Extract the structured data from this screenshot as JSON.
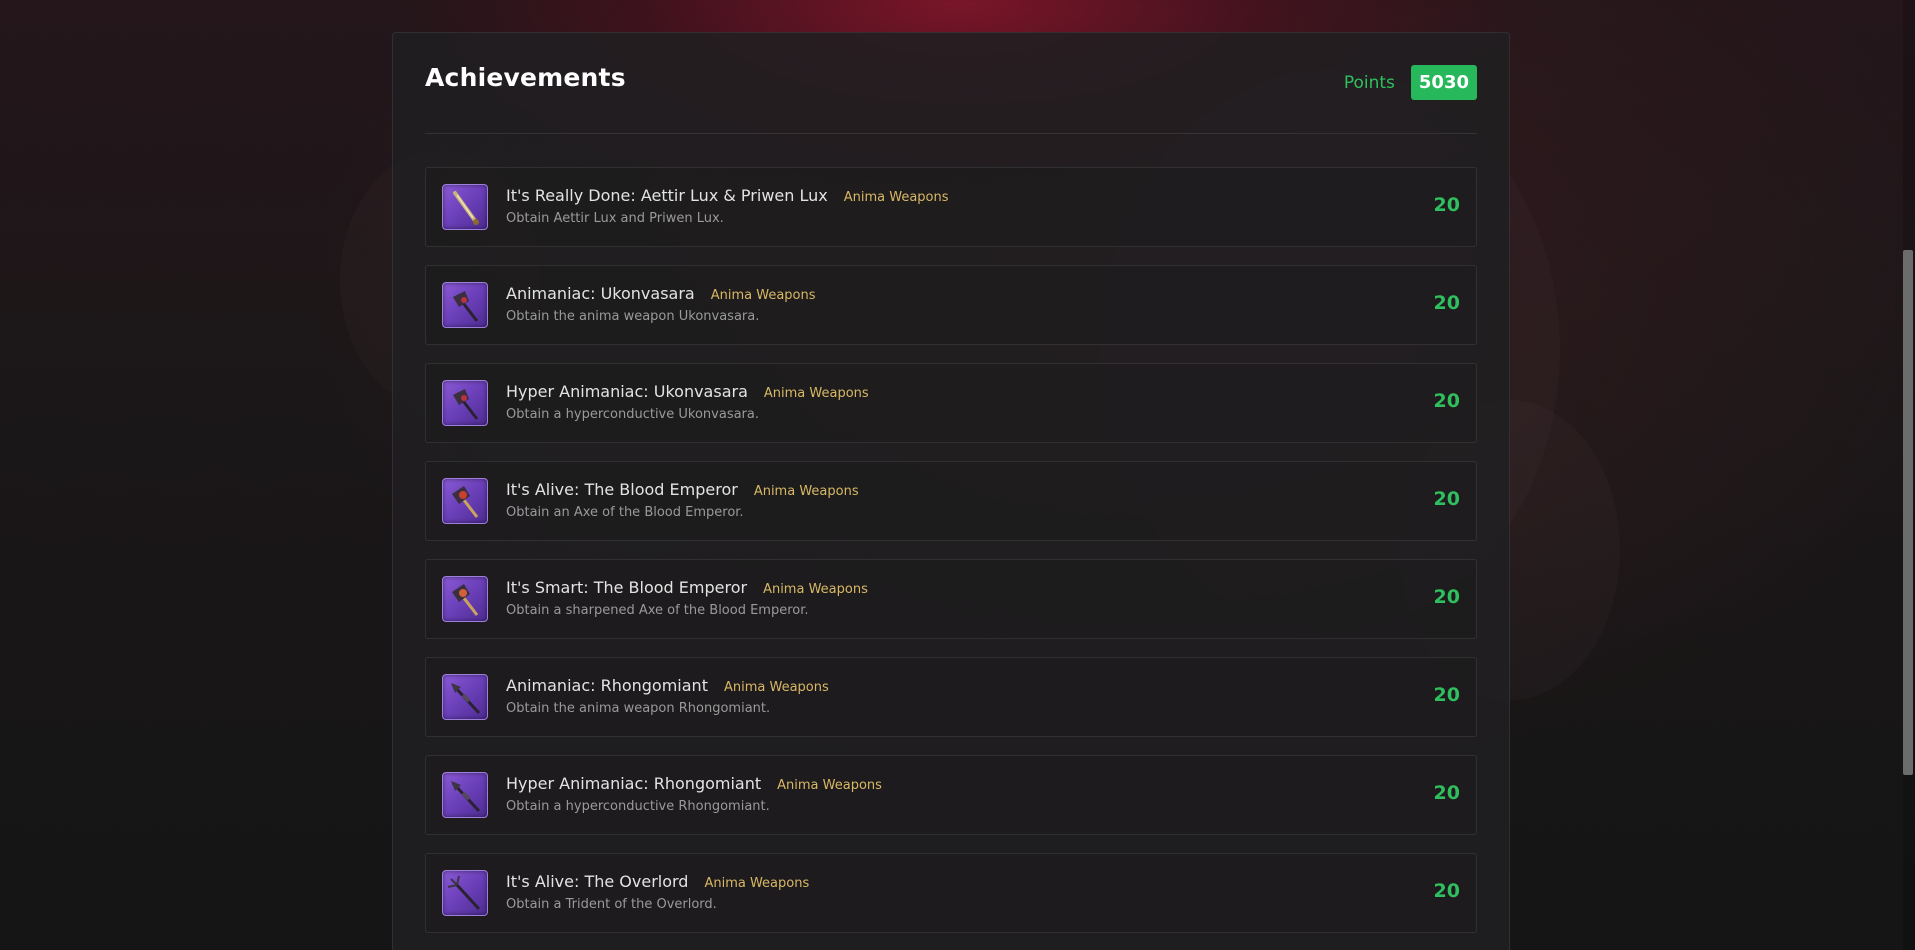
{
  "page": {
    "title": "Achievements",
    "points_label": "Points",
    "points_value": "5030"
  },
  "colors": {
    "accent_green": "#26b85a",
    "category_gold": "#d8b865",
    "icon_purple": "#6a3fb8"
  },
  "achievements": [
    {
      "title": "It's Really Done: Aettir Lux & Priwen Lux",
      "category": "Anima Weapons",
      "description": "Obtain Aettir Lux and Priwen Lux.",
      "points": "20",
      "icon": "sword-icon"
    },
    {
      "title": "Animaniac: Ukonvasara",
      "category": "Anima Weapons",
      "description": "Obtain the anima weapon Ukonvasara.",
      "points": "20",
      "icon": "axe-icon"
    },
    {
      "title": "Hyper Animaniac: Ukonvasara",
      "category": "Anima Weapons",
      "description": "Obtain a hyperconductive Ukonvasara.",
      "points": "20",
      "icon": "axe-icon"
    },
    {
      "title": "It's Alive: The Blood Emperor",
      "category": "Anima Weapons",
      "description": "Obtain an Axe of the Blood Emperor.",
      "points": "20",
      "icon": "axe-icon"
    },
    {
      "title": "It's Smart: The Blood Emperor",
      "category": "Anima Weapons",
      "description": "Obtain a sharpened Axe of the Blood Emperor.",
      "points": "20",
      "icon": "axe-icon"
    },
    {
      "title": "Animaniac: Rhongomiant",
      "category": "Anima Weapons",
      "description": "Obtain the anima weapon Rhongomiant.",
      "points": "20",
      "icon": "spear-icon"
    },
    {
      "title": "Hyper Animaniac: Rhongomiant",
      "category": "Anima Weapons",
      "description": "Obtain a hyperconductive Rhongomiant.",
      "points": "20",
      "icon": "spear-icon"
    },
    {
      "title": "It's Alive: The Overlord",
      "category": "Anima Weapons",
      "description": "Obtain a Trident of the Overlord.",
      "points": "20",
      "icon": "trident-icon"
    }
  ]
}
